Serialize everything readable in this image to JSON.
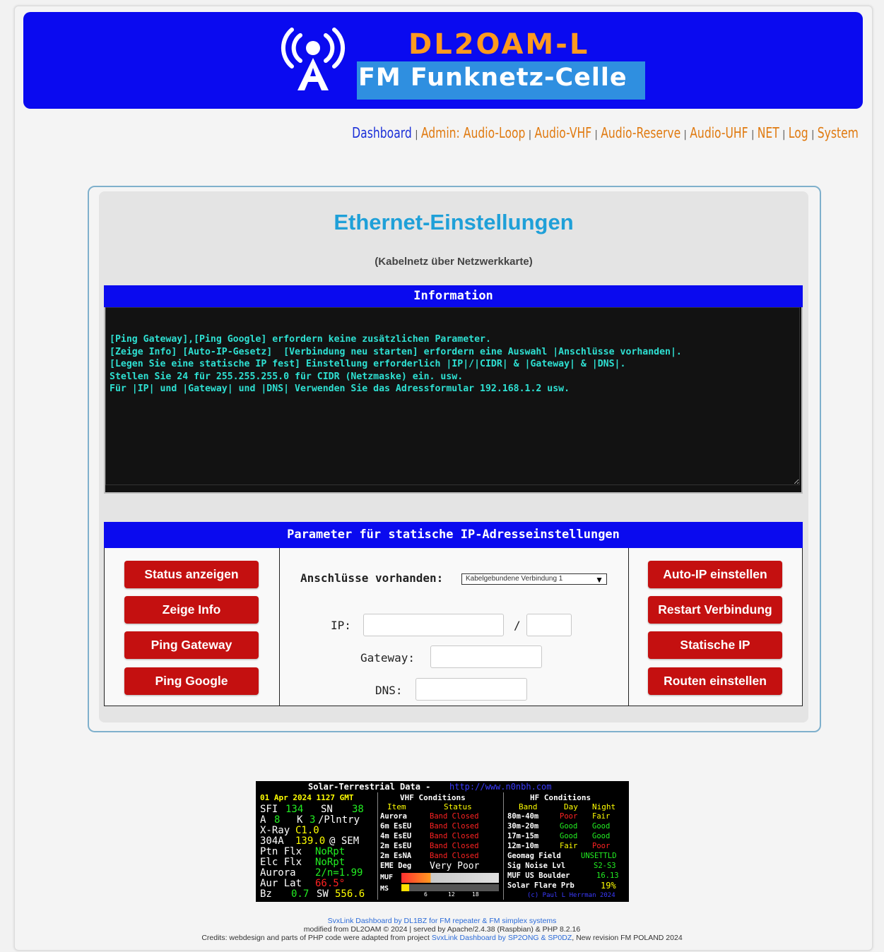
{
  "header": {
    "callsign": "DL2OAM-L",
    "subtitle": "FM Funknetz-Celle",
    "logo_icon": "radio-tower-icon",
    "colors": {
      "banner": "#0a0af0",
      "callsign": "#ff9a1f",
      "subtitle_bg": "#2f8fe0"
    }
  },
  "nav": {
    "items": [
      {
        "label": "Dashboard",
        "active": true
      },
      {
        "label": "Admin: Audio-Loop"
      },
      {
        "label": "Audio-VHF"
      },
      {
        "label": "Audio-Reserve"
      },
      {
        "label": "Audio-UHF"
      },
      {
        "label": "NET"
      },
      {
        "label": "Log"
      },
      {
        "label": "System"
      }
    ],
    "separator": "|"
  },
  "panel": {
    "title": "Ethernet-Einstellungen",
    "subtitle": "(Kabelnetz über Netzwerkkarte)"
  },
  "info": {
    "header": "Information",
    "lines": [
      "[Ping Gateway],[Ping Google] erfordern keine zusätzlichen Parameter.",
      "[Zeige Info] [Auto-IP-Gesetz]  [Verbindung neu starten] erfordern eine Auswahl |Anschlüsse vorhanden|.",
      "[Legen Sie eine statische IP fest] Einstellung erforderlich |IP|/|CIDR| & |Gateway| & |DNS|.",
      "Stellen Sie 24 für 255.255.255.0 für CIDR (Netzmaske) ein. usw.",
      "Für |IP| und |Gateway| und |DNS| Verwenden Sie das Adressformular 192.168.1.2 usw."
    ]
  },
  "params": {
    "header": "Parameter für statische IP-Adresseinstellungen",
    "left_buttons": [
      "Status anzeigen",
      "Zeige Info",
      "Ping Gateway",
      "Ping Google"
    ],
    "right_buttons": [
      "Auto-IP einstellen",
      "Restart Verbindung",
      "Statische IP",
      "Routen einstellen"
    ],
    "connections_label": "Anschlüsse vorhanden:",
    "connections_selected": "Kabelgebundene Verbindung 1",
    "ip_label": "IP:",
    "cidr_sep": "/",
    "gateway_label": "Gateway:",
    "dns_label": "DNS:",
    "ip_value": "",
    "cidr_value": "",
    "gateway_value": "",
    "dns_value": ""
  },
  "solar": {
    "title": "Solar-Terrestrial Data -",
    "url": "http://www.n0nbh.com",
    "datetime": "01 Apr 2024 1127 GMT",
    "sfi_label": "SFI",
    "sfi": "134",
    "sn_label": "SN",
    "sn": "38",
    "a_label": "A",
    "a": "8",
    "k_label": "K",
    "k": "3",
    "k_suffix": "/Plntry",
    "xray_label": "X-Ray",
    "xray": "C1.0",
    "he304_label": "304A",
    "he304": "139.0",
    "he304_suffix": "@ SEM",
    "ptn_label": "Ptn Flx",
    "ptn": "NoRpt",
    "elc_label": "Elc Flx",
    "elc": "NoRpt",
    "aurora_label": "Aurora",
    "aurora": "2/n=1.99",
    "aurlat_label": "Aur Lat",
    "aurlat": "66.5°",
    "bz_label": "Bz",
    "bz": "0.7",
    "sw_label": "SW",
    "sw": "556.6",
    "vhf_title": "VHF Conditions",
    "vhf_item_header": "Item",
    "vhf_status_header": "Status",
    "vhf_rows": [
      {
        "item": "Aurora",
        "status": "Band Closed"
      },
      {
        "item": "6m EsEU",
        "status": "Band Closed"
      },
      {
        "item": "4m EsEU",
        "status": "Band Closed"
      },
      {
        "item": "2m EsEU",
        "status": "Band Closed"
      },
      {
        "item": "2m EsNA",
        "status": "Band Closed"
      },
      {
        "item": "EME Deg",
        "status": "Very Poor"
      }
    ],
    "muf_label": "MUF",
    "ms_label": "MS",
    "scale_ticks": [
      "6",
      "12",
      "18"
    ],
    "hf_title": "HF Conditions",
    "hf_band_header": "Band",
    "hf_day_header": "Day",
    "hf_night_header": "Night",
    "hf_rows": [
      {
        "band": "80m-40m",
        "day": "Poor",
        "night": "Fair"
      },
      {
        "band": "30m-20m",
        "day": "Good",
        "night": "Good"
      },
      {
        "band": "17m-15m",
        "day": "Good",
        "night": "Good"
      },
      {
        "band": "12m-10m",
        "day": "Fair",
        "night": "Poor"
      }
    ],
    "geomag_label": "Geomag Field",
    "geomag": "UNSETTLD",
    "signoise_label": "Sig Noise Lvl",
    "signoise": "S2-S3",
    "muf_boulder_label": "MUF US Boulder",
    "muf_boulder": "16.13",
    "flare_label": "Solar Flare Prb",
    "flare": "19%",
    "footer_credit": "(c) Paul L Herrman 2024"
  },
  "footer": {
    "line1_link": "SvxLink Dashboard by DL1BZ for FM repeater & FM simplex systems",
    "line2": "modified from DL2OAM © 2024 | served by Apache/2.4.38 (Raspbian) & PHP 8.2.16",
    "line3_prefix": "Credits: webdesign and parts of PHP code were adapted from project",
    "line3_link": "SvxLink Dashboard by SP2ONG & SP0DZ",
    "line3_suffix": ", New revision FM POLAND 2024"
  }
}
